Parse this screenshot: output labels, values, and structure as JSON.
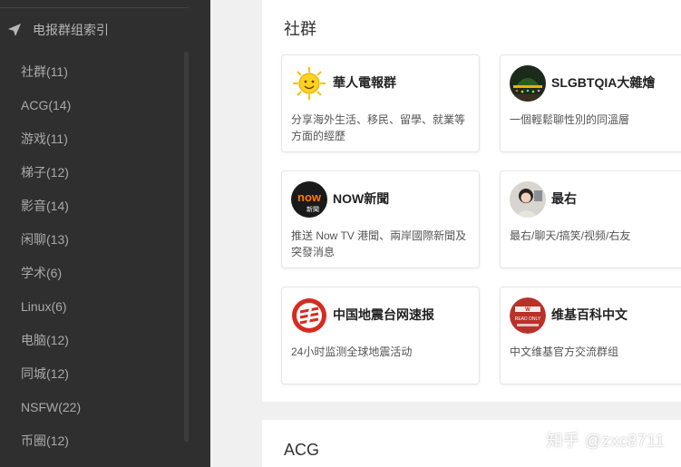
{
  "sidebar": {
    "header": "电报群组索引",
    "items": [
      {
        "label": "社群(11)"
      },
      {
        "label": "ACG(14)"
      },
      {
        "label": "游戏(11)"
      },
      {
        "label": "梯子(12)"
      },
      {
        "label": "影音(14)"
      },
      {
        "label": "闲聊(13)"
      },
      {
        "label": "学术(6)"
      },
      {
        "label": "Linux(6)"
      },
      {
        "label": "电脑(12)"
      },
      {
        "label": "同城(12)"
      },
      {
        "label": "NSFW(22)"
      },
      {
        "label": "币圈(12)"
      }
    ]
  },
  "sections": [
    {
      "title": "社群",
      "cards": [
        {
          "title": "華人電報群",
          "desc": "分享海外生活、移民、留學、就業等方面的經歷",
          "icon": "sun-avatar-icon"
        },
        {
          "title": "SLGBTQIA大雜燴",
          "desc": "一個輕鬆聊性別的同溫層",
          "icon": "night-lights-avatar-icon"
        },
        {
          "title": "NOW新聞",
          "desc": "推送 Now TV 港聞、兩岸國際新聞及突發消息",
          "icon": "now-news-logo-icon",
          "logo_text": "now",
          "logo_sub": "新聞"
        },
        {
          "title": "最右",
          "desc": "最右/聊天/搞笑/视频/右友",
          "icon": "person-photo-avatar-icon"
        },
        {
          "title": "中国地震台网速报",
          "desc": "24小时监测全球地震活动",
          "icon": "earthquake-logo-icon"
        },
        {
          "title": "维基百科中文",
          "desc": "中文维基官方交流群组",
          "icon": "wikipedia-logo-icon",
          "logo_text": "READ ONLY"
        }
      ]
    },
    {
      "title": "ACG"
    }
  ],
  "watermark": "知乎 @zxc8711",
  "colors": {
    "sidebar_bg": "#2f2f2f",
    "page_bg": "#f0f0f0",
    "card_border": "#e6e6e6"
  }
}
